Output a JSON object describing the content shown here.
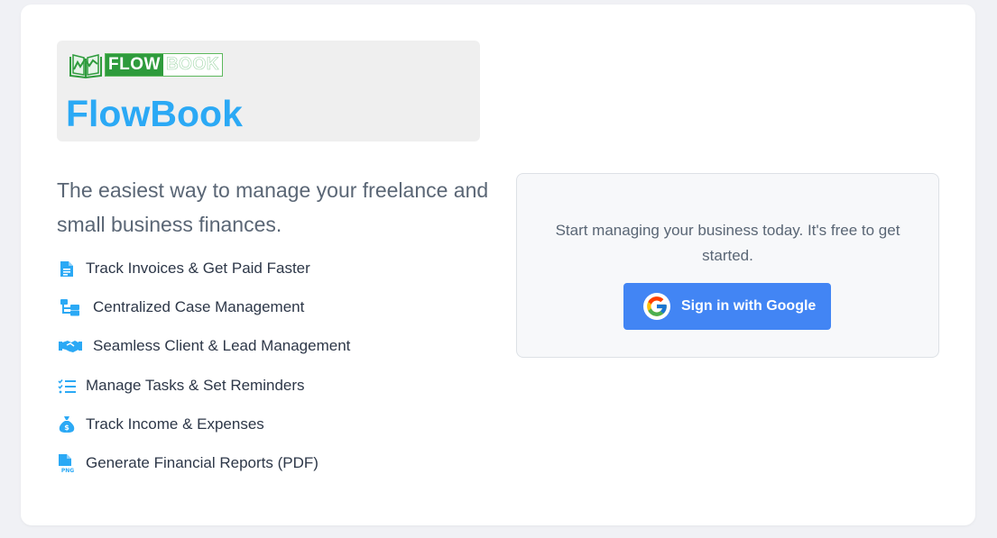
{
  "brand": {
    "logo_flow": "FLOW",
    "logo_book": "BOOK",
    "title": "FlowBook",
    "accent_color": "#2ba9f5",
    "logo_green": "#2e9b3c"
  },
  "tagline": "The easiest way to manage your freelance and small business finances.",
  "features": [
    {
      "icon": "invoice-file-icon",
      "label": "Track Invoices & Get Paid Faster"
    },
    {
      "icon": "folder-tree-icon",
      "label": "Centralized Case Management"
    },
    {
      "icon": "handshake-icon",
      "label": "Seamless Client & Lead Management"
    },
    {
      "icon": "task-list-icon",
      "label": "Manage Tasks & Set Reminders"
    },
    {
      "icon": "money-bag-icon",
      "label": "Track Income & Expenses"
    },
    {
      "icon": "png-file-icon",
      "label": "Generate Financial Reports (PDF)"
    }
  ],
  "signin": {
    "prompt": "Start managing your business today. It's free to get started.",
    "google_button_label": "Sign in with Google",
    "button_color": "#4285f4"
  }
}
